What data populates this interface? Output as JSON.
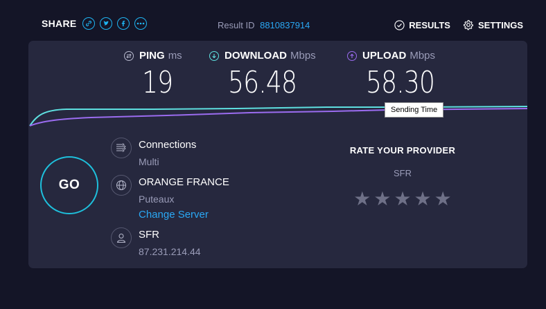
{
  "header": {
    "share_label": "SHARE",
    "share_buttons": [
      {
        "icon": "link-icon",
        "glyph": "🔗"
      },
      {
        "icon": "twitter-icon",
        "glyph": "t"
      },
      {
        "icon": "facebook-icon",
        "glyph": "f"
      },
      {
        "icon": "more-icon",
        "glyph": "•••"
      }
    ],
    "result_id_label": "Result ID",
    "result_id_value": "8810837914",
    "results_label": "RESULTS",
    "settings_label": "SETTINGS"
  },
  "metrics": {
    "ping": {
      "label": "PING",
      "unit": "ms",
      "value": "19"
    },
    "download": {
      "label": "DOWNLOAD",
      "unit": "Mbps",
      "value": "56.48"
    },
    "upload": {
      "label": "UPLOAD",
      "unit": "Mbps",
      "value": "58.30"
    }
  },
  "tooltip": "Sending Time",
  "go_label": "GO",
  "connections": {
    "title": "Connections",
    "value": "Multi"
  },
  "server": {
    "name": "ORANGE FRANCE",
    "location": "Puteaux",
    "change_label": "Change Server"
  },
  "isp": {
    "name": "SFR",
    "ip": "87.231.214.44"
  },
  "rate": {
    "title": "RATE YOUR PROVIDER",
    "provider": "SFR",
    "stars": 5
  },
  "colors": {
    "accent_blue": "#2aa8f5",
    "download_cyan": "#5ee0e0",
    "upload_purple": "#9b6cf0",
    "panel": "#26283e",
    "background": "#141527"
  }
}
